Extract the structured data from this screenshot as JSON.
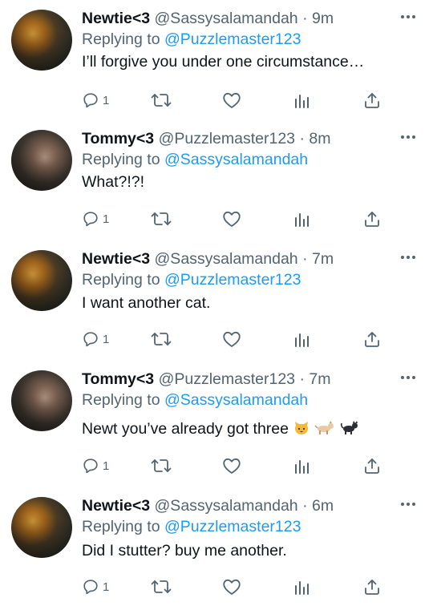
{
  "tweets": [
    {
      "name": "Newtie<3",
      "handle": "@Sassysalamandah",
      "time": "· 9m",
      "replying_prefix": "Replying to",
      "replying_to": "@Puzzlemaster123",
      "text": "I’ll forgive you under one circumstance…",
      "reply_count": "1",
      "avatar": "newt"
    },
    {
      "name": "Tommy<3",
      "handle": "@Puzzlemaster123",
      "time": "· 8m",
      "replying_prefix": "Replying to",
      "replying_to": "@Sassysalamandah",
      "text": "What?!?!",
      "reply_count": "1",
      "avatar": "tommy"
    },
    {
      "name": "Newtie<3",
      "handle": "@Sassysalamandah",
      "time": "· 7m",
      "replying_prefix": "Replying to",
      "replying_to": "@Puzzlemaster123",
      "text": "I want another cat.",
      "reply_count": "1",
      "avatar": "newt"
    },
    {
      "name": "Tommy<3",
      "handle": "@Puzzlemaster123",
      "time": "· 7m",
      "replying_prefix": "Replying to",
      "replying_to": "@Sassysalamandah",
      "text": "Newt you’ve already got three",
      "text_emoji": [
        "cat-face-emoji",
        "dog-emoji",
        "black-cat-emoji"
      ],
      "reply_count": "1",
      "avatar": "tommy"
    },
    {
      "name": "Newtie<3",
      "handle": "@Sassysalamandah",
      "time": "· 6m",
      "replying_prefix": "Replying to",
      "replying_to": "@Puzzlemaster123",
      "text": "Did I stutter? buy me another.",
      "reply_count": "1",
      "avatar": "newt"
    }
  ],
  "icons": [
    "reply-icon",
    "retweet-icon",
    "like-icon",
    "analytics-icon",
    "share-icon",
    "more-icon"
  ],
  "colors": {
    "text": "#0f1419",
    "secondary": "#536471",
    "link": "#1d9bf0"
  }
}
